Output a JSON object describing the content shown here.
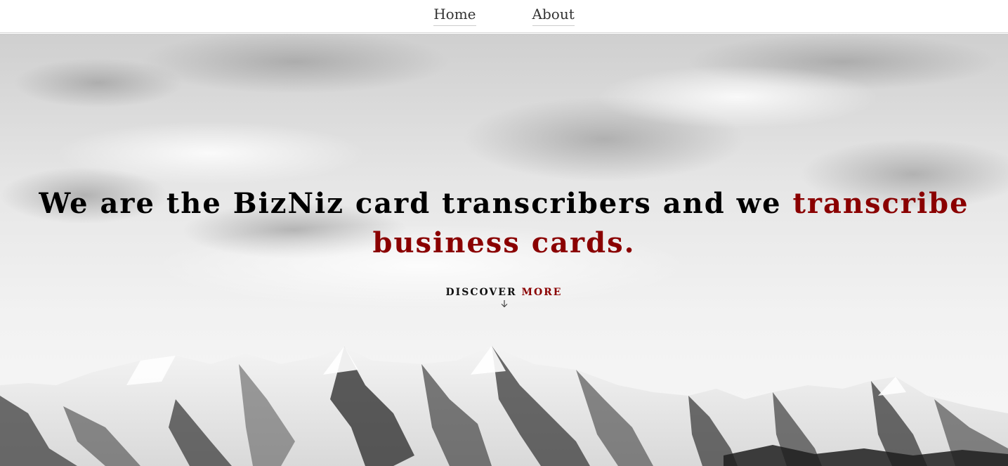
{
  "nav": {
    "home_label": "Home",
    "about_label": "About"
  },
  "hero": {
    "headline_plain": "We are the BizNiz card transcribers and we ",
    "headline_accent_line1": "transcribe",
    "headline_accent_line2": "business cards.",
    "discover_plain": "DISCOVER",
    "discover_accent": "MORE",
    "discover_icon": "arrow-down-icon"
  },
  "colors": {
    "accent": "#8a0000",
    "text": "#000000",
    "nav_text": "#333333",
    "background": "#ffffff"
  }
}
